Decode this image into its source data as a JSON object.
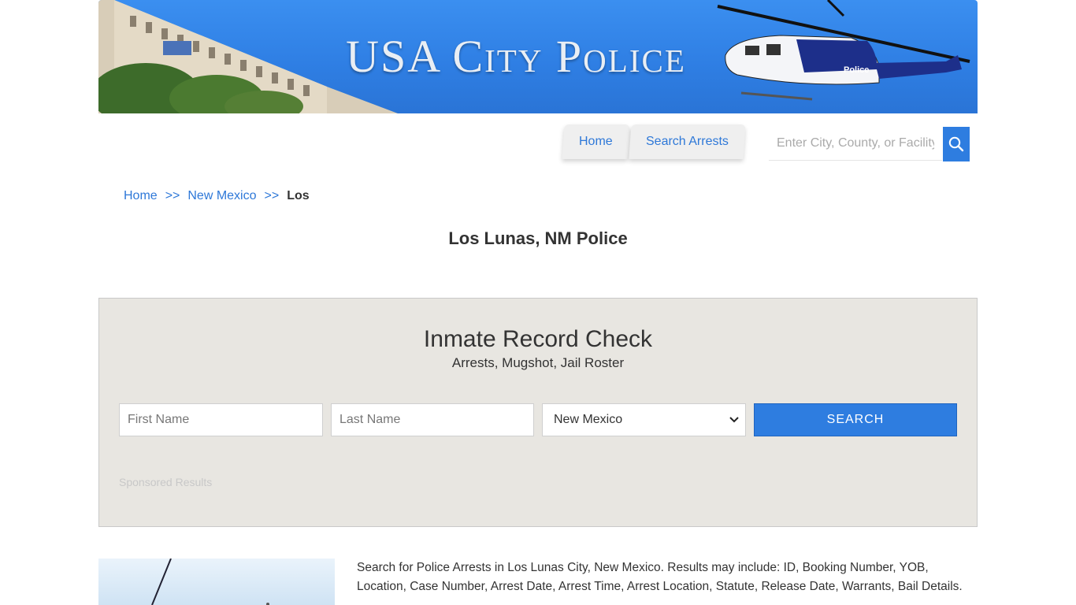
{
  "banner": {
    "title": "USA City Police",
    "heli_text": "Police"
  },
  "nav": {
    "tabs": [
      "Home",
      "Search Arrests"
    ]
  },
  "search": {
    "placeholder": "Enter City, County, or Facility"
  },
  "breadcrumb": {
    "home": "Home",
    "sep": ">>",
    "state": "New Mexico",
    "current": "Los"
  },
  "page": {
    "title": "Los Lunas, NM Police"
  },
  "record_check": {
    "title": "Inmate Record Check",
    "subtitle": "Arrests, Mugshot, Jail Roster",
    "first_placeholder": "First Name",
    "last_placeholder": "Last Name",
    "state_value": "New Mexico",
    "button": "SEARCH",
    "sponsored": "Sponsored Results"
  },
  "content": {
    "description": "Search for Police Arrests in Los Lunas City, New Mexico. Results may include: ID, Booking Number, YOB, Location, Case Number, Arrest Date, Arrest Time, Arrest Location, Statute, Release Date, Warrants, Bail Details."
  },
  "colors": {
    "accent": "#2e7de0",
    "panel": "#e8e6e1"
  },
  "icons": [
    "search-icon",
    "chevron-down-icon"
  ]
}
